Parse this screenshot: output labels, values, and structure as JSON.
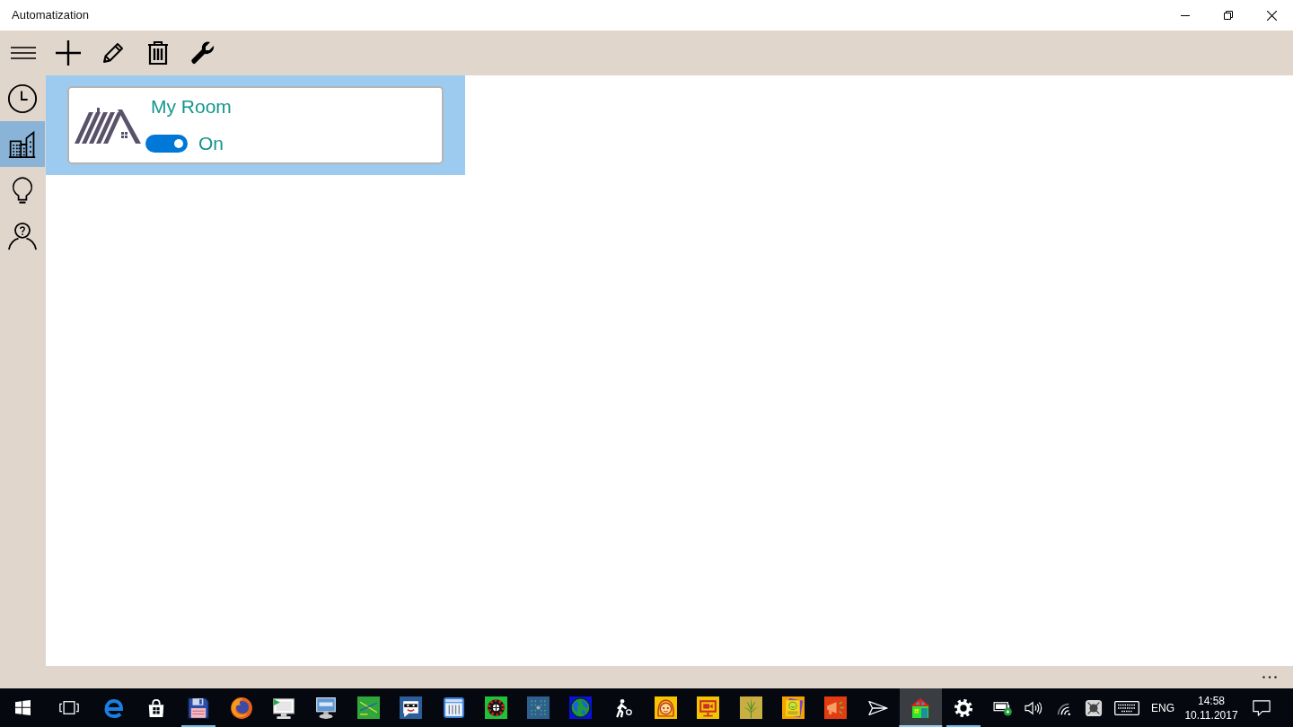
{
  "window": {
    "title": "Automatization"
  },
  "sidebar": {
    "items": [
      {
        "kind": "clock",
        "selected": false
      },
      {
        "kind": "building",
        "selected": true
      },
      {
        "kind": "bulb",
        "selected": false
      },
      {
        "kind": "person",
        "selected": false
      }
    ]
  },
  "rooms": [
    {
      "name": "My Room",
      "status": "On",
      "on": true,
      "selected": true
    }
  ],
  "taskbar": {
    "apps": [
      {
        "kind": "start",
        "running": false,
        "selected": false
      },
      {
        "kind": "taskview",
        "running": false,
        "selected": false
      },
      {
        "kind": "e",
        "running": false,
        "selected": false
      },
      {
        "kind": "bag",
        "running": false,
        "selected": false
      },
      {
        "kind": "floppy",
        "running": true,
        "selected": false
      },
      {
        "kind": "fox",
        "running": false,
        "selected": false
      },
      {
        "kind": "monitor",
        "running": false,
        "selected": false
      },
      {
        "kind": "computer",
        "running": false,
        "selected": false
      },
      {
        "kind": "chart",
        "running": false,
        "selected": false
      },
      {
        "kind": "mask",
        "running": false,
        "selected": false
      },
      {
        "kind": "calendar",
        "running": false,
        "selected": false
      },
      {
        "kind": "roulette",
        "running": false,
        "selected": false
      },
      {
        "kind": "dots",
        "running": false,
        "selected": false
      },
      {
        "kind": "globe",
        "running": false,
        "selected": false
      },
      {
        "kind": "walker",
        "running": false,
        "selected": false
      },
      {
        "kind": "girl",
        "running": false,
        "selected": false
      },
      {
        "kind": "tv",
        "running": false,
        "selected": false
      },
      {
        "kind": "leaf",
        "running": false,
        "selected": false
      },
      {
        "kind": "notes",
        "running": false,
        "selected": false
      },
      {
        "kind": "megaphone",
        "running": false,
        "selected": false
      },
      {
        "kind": "plane",
        "running": false,
        "selected": false
      },
      {
        "kind": "house",
        "running": true,
        "selected": true
      },
      {
        "kind": "gear",
        "running": true,
        "selected": false
      }
    ],
    "tray": {
      "language": "ENG",
      "time": "14:58",
      "date": "10.11.2017"
    }
  }
}
